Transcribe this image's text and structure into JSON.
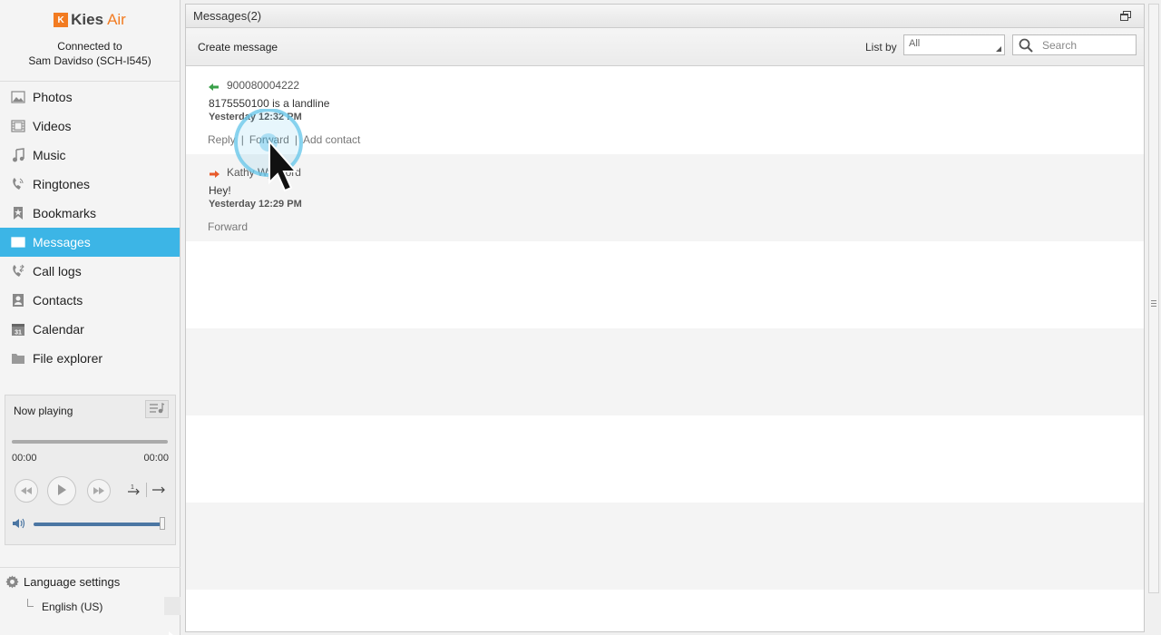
{
  "app": {
    "logo_mark": "K",
    "logo_word": "Kies",
    "logo_suffix": "Air"
  },
  "connection": {
    "line1": "Connected to",
    "line2": "Sam Davidso (SCH-I545)"
  },
  "sidebar": {
    "items": [
      {
        "label": "Photos",
        "icon": "photo-icon",
        "active": false
      },
      {
        "label": "Videos",
        "icon": "video-icon",
        "active": false
      },
      {
        "label": "Music",
        "icon": "music-icon",
        "active": false
      },
      {
        "label": "Ringtones",
        "icon": "ringtone-icon",
        "active": false
      },
      {
        "label": "Bookmarks",
        "icon": "bookmark-icon",
        "active": false
      },
      {
        "label": "Messages",
        "icon": "envelope-icon",
        "active": true
      },
      {
        "label": "Call logs",
        "icon": "phone-icon",
        "active": false
      },
      {
        "label": "Contacts",
        "icon": "contact-icon",
        "active": false
      },
      {
        "label": "Calendar",
        "icon": "calendar-icon",
        "active": false
      },
      {
        "label": "File explorer",
        "icon": "folder-icon",
        "active": false
      }
    ]
  },
  "player": {
    "title": "Now playing",
    "time_elapsed": "00:00",
    "time_total": "00:00",
    "repeat_label": "1",
    "volume_fraction": 1.0
  },
  "language": {
    "heading": "Language settings",
    "value": "English (US)"
  },
  "main": {
    "title": "Messages(2)",
    "create_label": "Create message",
    "list_by_label": "List by",
    "list_by_value": "All",
    "search_placeholder": "Search"
  },
  "messages": [
    {
      "direction": "incoming",
      "sender": "900080004222",
      "body": "8175550100 is a landline",
      "time": "Yesterday 12:32 PM",
      "actions": [
        "Reply",
        "Forward",
        "Add contact"
      ]
    },
    {
      "direction": "outgoing",
      "sender": "Kathy Wyngord",
      "body": "Hey!",
      "time": "Yesterday 12:29 PM",
      "actions": [
        "Forward"
      ]
    }
  ],
  "colors": {
    "accent": "#3cb5e6",
    "brand": "#f27b21",
    "incoming_arrow": "#3aa04a",
    "outgoing_arrow": "#e85a2a"
  }
}
